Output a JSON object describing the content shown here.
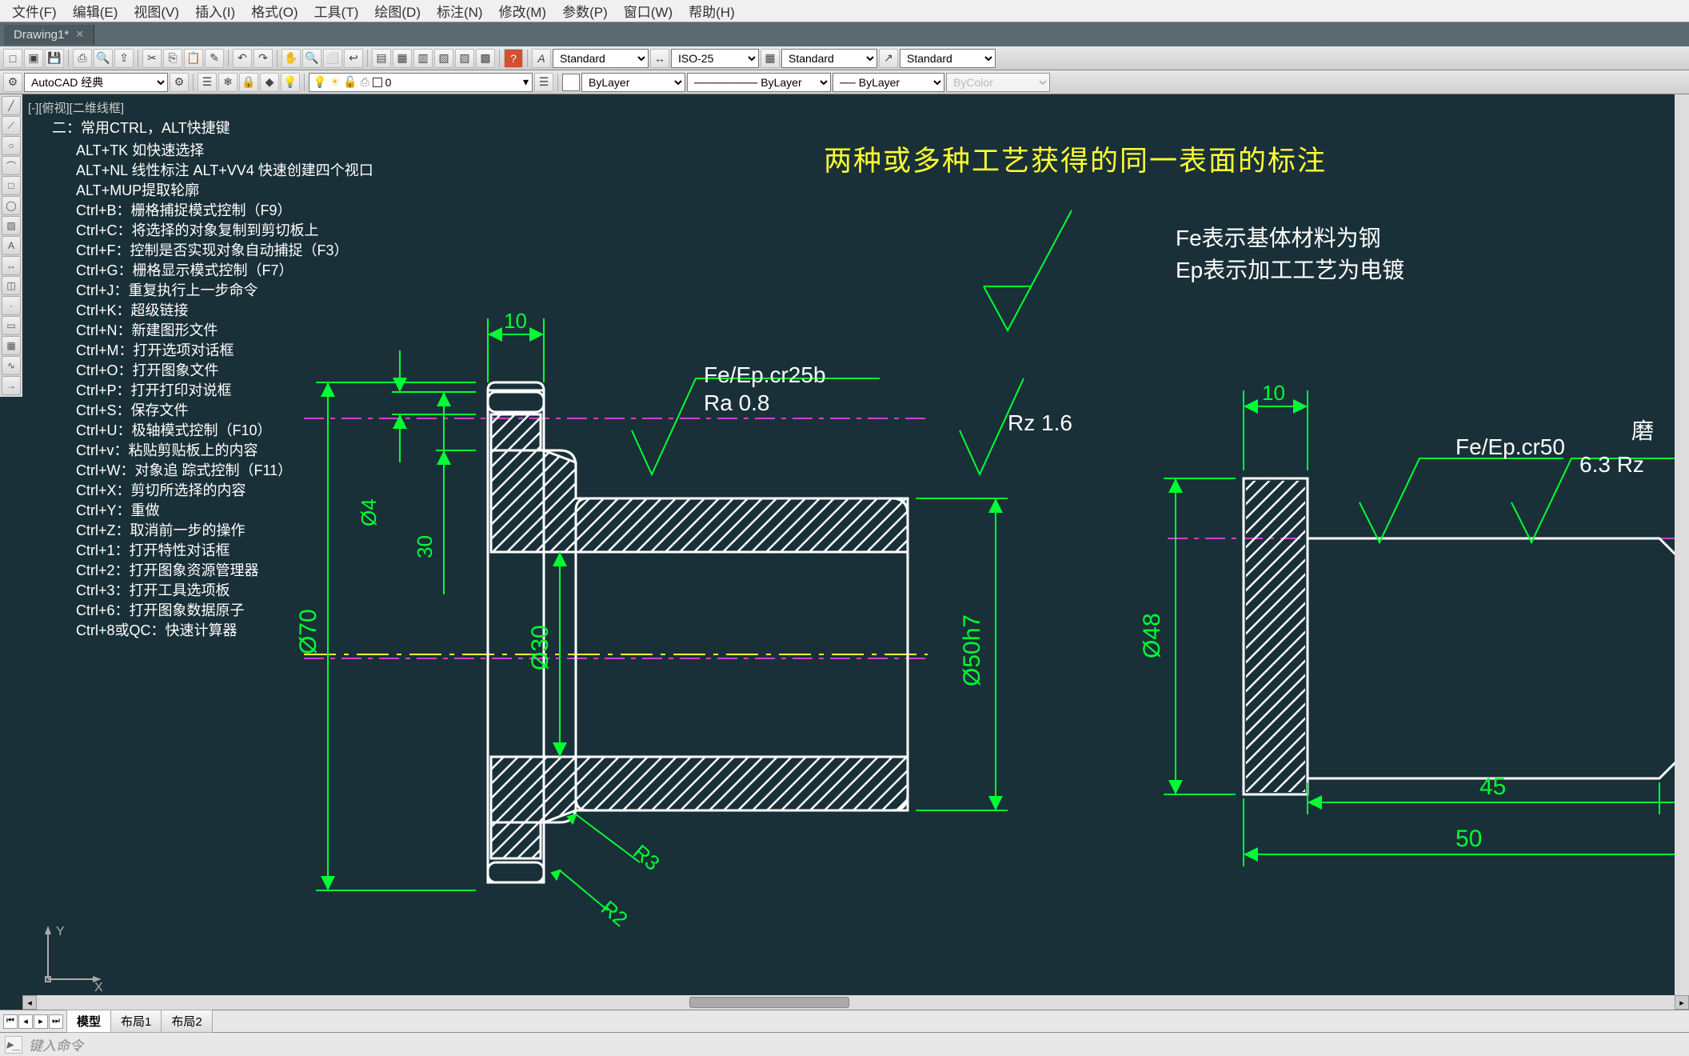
{
  "menu": {
    "file": "文件(F)",
    "edit": "编辑(E)",
    "view": "视图(V)",
    "insert": "插入(I)",
    "format": "格式(O)",
    "tools": "工具(T)",
    "draw": "绘图(D)",
    "dimension": "标注(N)",
    "modify": "修改(M)",
    "params": "参数(P)",
    "window": "窗口(W)",
    "help": "帮助(H)"
  },
  "tab": {
    "name": "Drawing1*"
  },
  "toolbar1": {
    "style1": "Standard",
    "style2": "ISO-25",
    "style3": "Standard",
    "style4": "Standard"
  },
  "toolbar2": {
    "workspace": "AutoCAD 经典",
    "layer": "ByLayer",
    "ltype": "ByLayer",
    "lwt": "ByLayer",
    "pstyle": "ByColor"
  },
  "viewport_label": "[-][俯视][二维线框]",
  "shortcuts": {
    "header": "二：常用CTRL，ALT快捷键",
    "rows": [
      "ALT+TK 如快速选择",
      "ALT+NL 线性标注 ALT+VV4 快速创建四个视口",
      "ALT+MUP提取轮廓",
      "Ctrl+B：栅格捕捉模式控制（F9）",
      "Ctrl+C：将选择的对象复制到剪切板上",
      "Ctrl+F：控制是否实现对象自动捕捉（F3）",
      "Ctrl+G：栅格显示模式控制（F7）",
      "Ctrl+J：重复执行上一步命令",
      "Ctrl+K：超级链接",
      "Ctrl+N：新建图形文件",
      "Ctrl+M：打开选项对话框",
      "Ctrl+O：打开图象文件",
      "Ctrl+P：打开打印对说框",
      "Ctrl+S：保存文件",
      "Ctrl+U：极轴模式控制（F10）",
      "Ctrl+v：粘贴剪贴板上的内容",
      "Ctrl+W：对象追 踪式控制（F11）",
      "Ctrl+X：剪切所选择的内容",
      "Ctrl+Y：重做",
      "Ctrl+Z：取消前一步的操作",
      "Ctrl+1：打开特性对话框",
      "Ctrl+2：打开图象资源管理器",
      "Ctrl+3：打开工具选项板",
      "Ctrl+6：打开图象数据原子",
      "Ctrl+8或QC：快速计算器"
    ]
  },
  "title_note": "两种或多种工艺获得的同一表面的标注",
  "anno_note": {
    "l1": "Fe表示基体材料为钢",
    "l2": "Ep表示加工工艺为电镀"
  },
  "drawing": {
    "dims_left": {
      "d10a": "10",
      "d4": "Ø4",
      "d30": "30",
      "d70": "Ø70",
      "d30i": "Ø30",
      "d50": "Ø50h7",
      "r3": "R3",
      "r2": "R2"
    },
    "surf_left": {
      "s1a": "Fe/Ep.cr25b",
      "s1b": "Ra 0.8",
      "s2": "Rz 1.6"
    },
    "dims_right": {
      "d10b": "10",
      "d48": "Ø48",
      "d45": "45",
      "d50b": "50"
    },
    "surf_right": {
      "s3": "Fe/Ep.cr50",
      "s4a": "磨",
      "s4b": "6.3 Rz"
    }
  },
  "layouts": {
    "model": "模型",
    "l1": "布局1",
    "l2": "布局2"
  },
  "cmd": {
    "prompt": "键入命令"
  }
}
